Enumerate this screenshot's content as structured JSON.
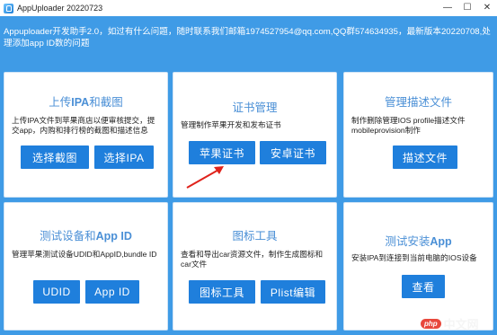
{
  "window": {
    "title": "AppUploader 20220723",
    "minimize": "—",
    "maximize": "☐",
    "close": "✕"
  },
  "notice": "Appuploader开发助手2.0，如过有什么问题，随时联系我们邮箱1974527954@qq.com,QQ群574634935，最新版本20220708,处理添加app ID数的问题",
  "cards": {
    "upload": {
      "title_prefix": "上传",
      "title_bold": "IPA",
      "title_suffix": "和截图",
      "desc": "上传IPA文件到苹果商店以便审核提交，提交app，内购和排行榜的截图和描述信息",
      "buttons": [
        "选择截图",
        "选择IPA"
      ]
    },
    "certificate": {
      "title": "证书管理",
      "desc": "管理制作苹果开发和发布证书",
      "buttons": [
        "苹果证书",
        "安卓证书"
      ]
    },
    "profile": {
      "title": "管理描述文件",
      "desc": "制作删除管理IOS profile描述文件mobileprovision制作",
      "buttons": [
        "描述文件"
      ]
    },
    "device": {
      "title_prefix": "测试设备和",
      "title_bold": "App ID",
      "desc": "管理苹果测试设备UDID和AppID,bundle ID",
      "buttons": [
        "UDID",
        "App ID"
      ]
    },
    "icon": {
      "title": "图标工具",
      "desc": "查看和导出car资源文件，制作生成图标和car文件",
      "buttons": [
        "图标工具",
        "Plist编辑"
      ]
    },
    "install": {
      "title_prefix": "测试安装",
      "title_bold": "App",
      "desc": "安装IPA到连接到当前电脑的IOS设备",
      "buttons": [
        "查看"
      ]
    }
  },
  "watermark": {
    "badge": "php",
    "text": "中文网"
  },
  "colors": {
    "background": "#3f9be6",
    "button": "#1f7fdc",
    "title_text": "#4a8fd6",
    "arrow": "#e0221b"
  }
}
